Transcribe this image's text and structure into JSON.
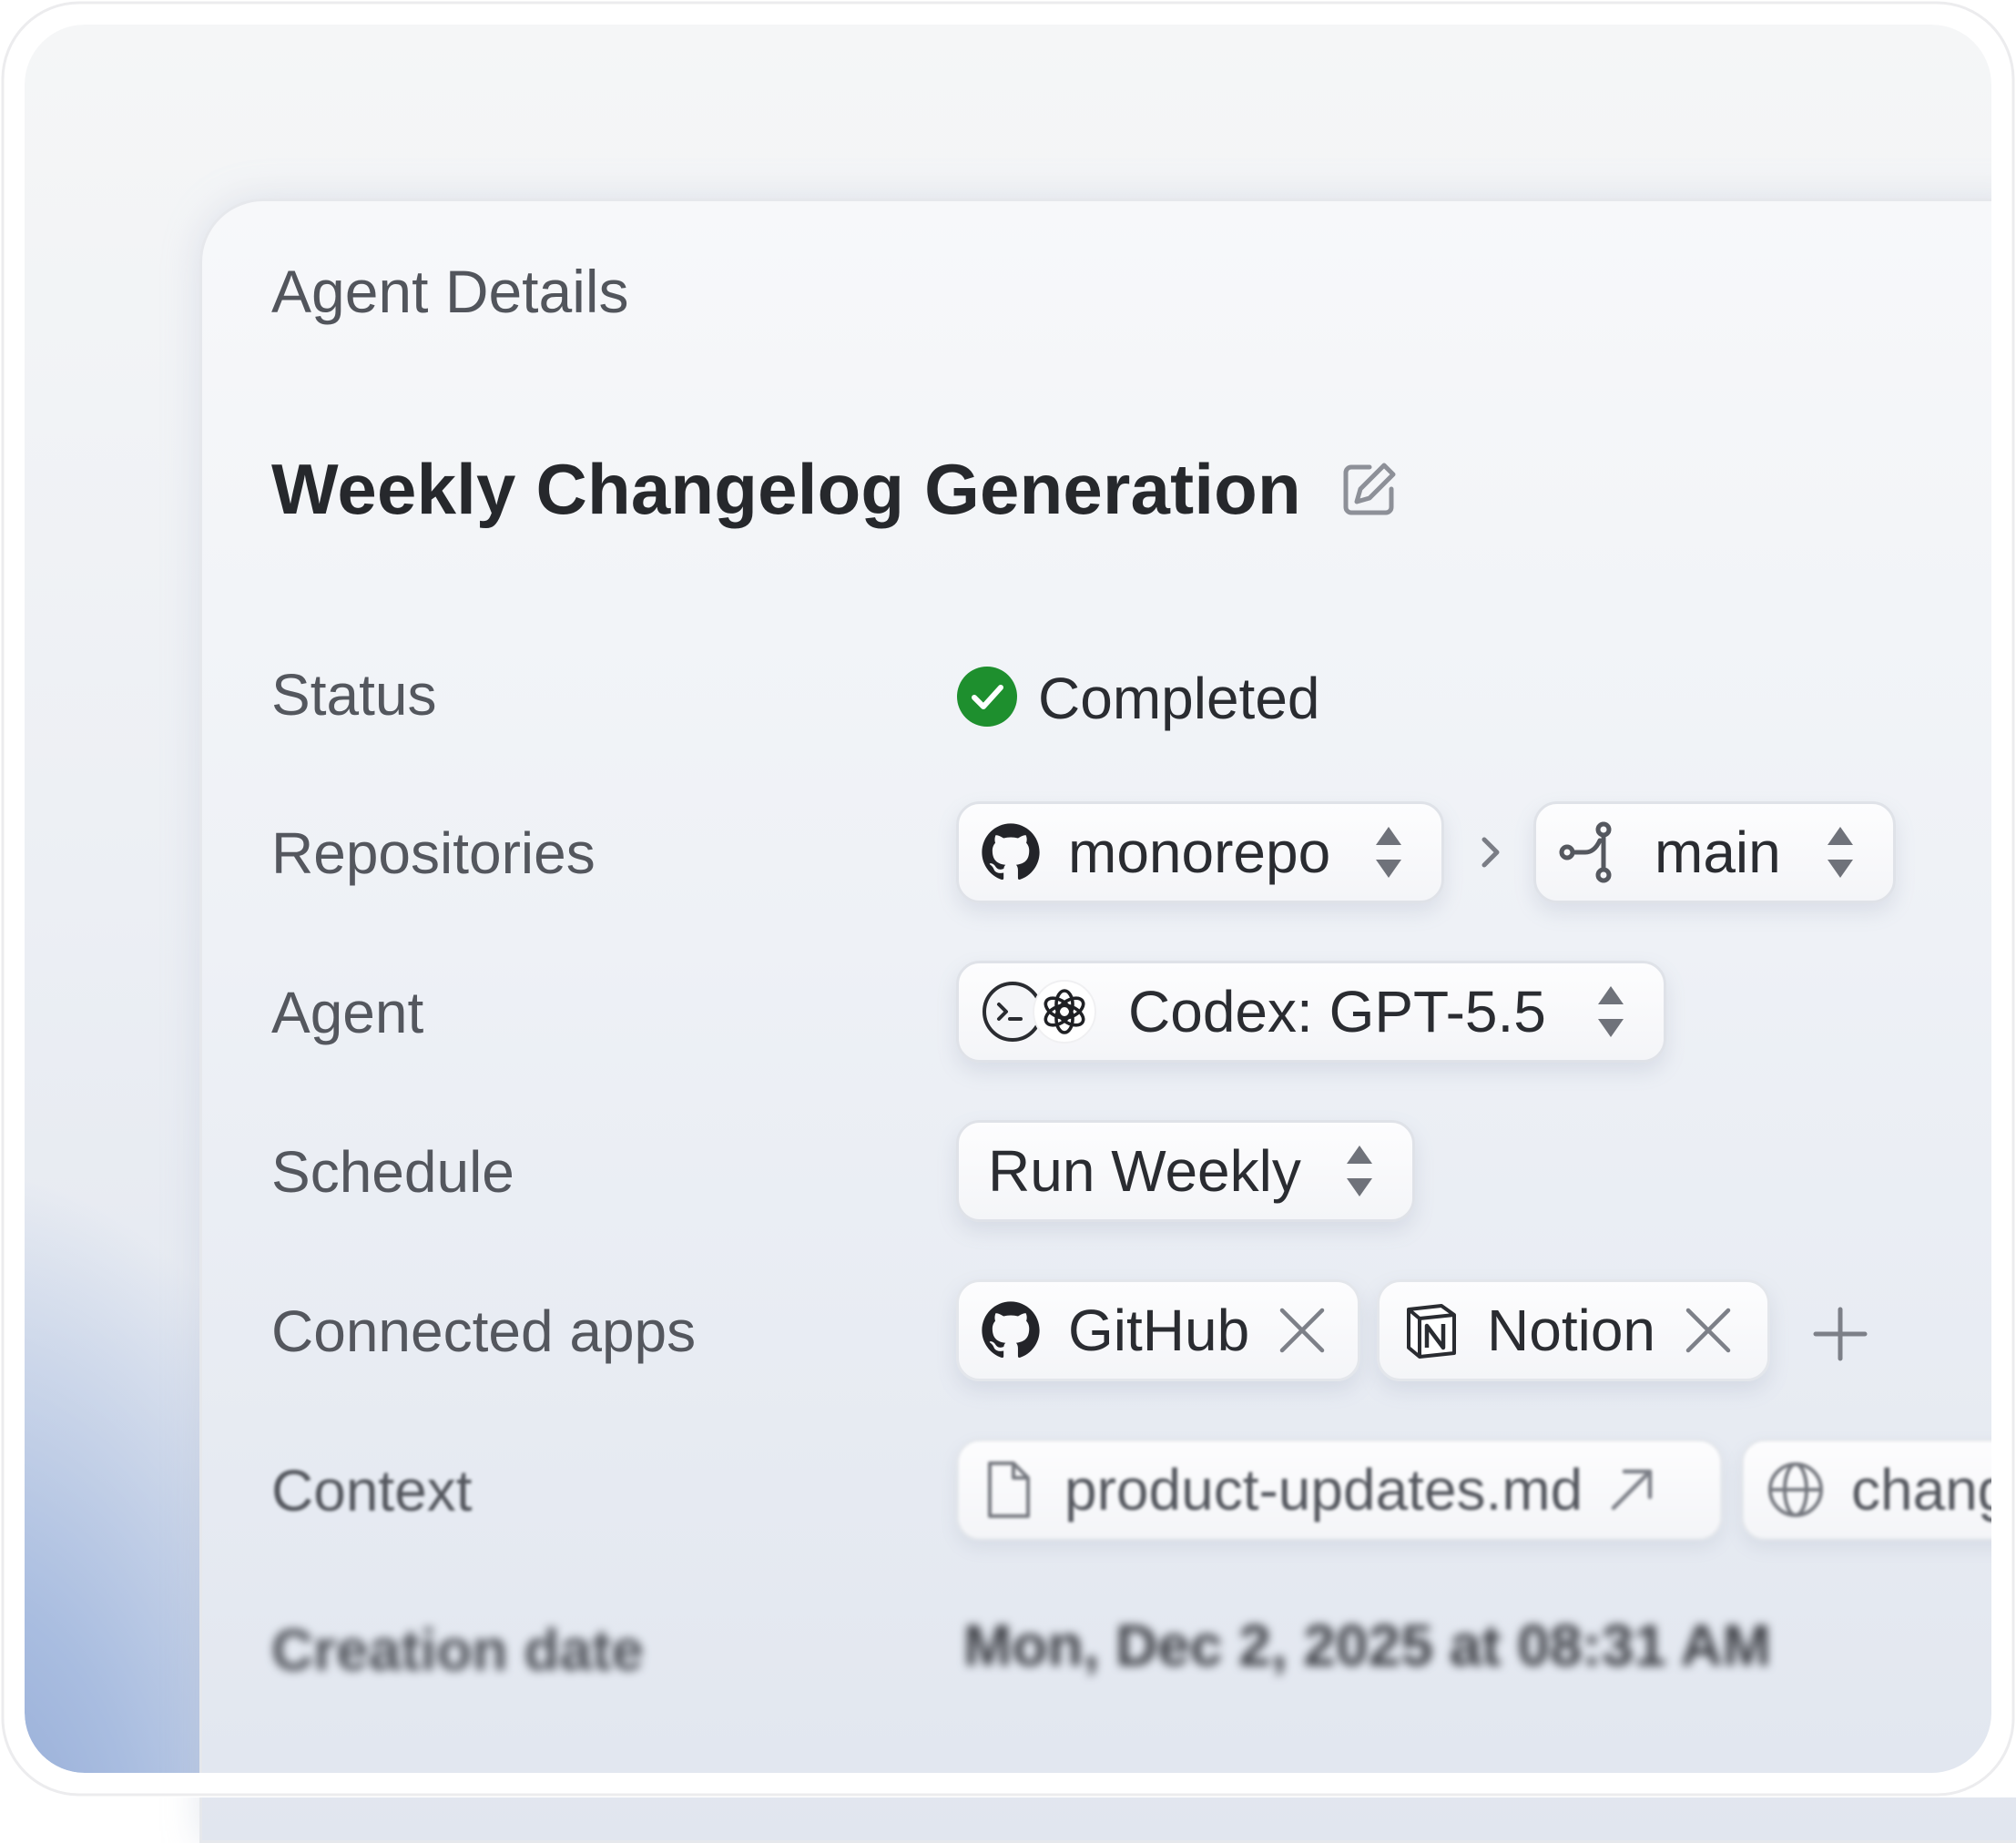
{
  "header": {
    "title": "Agent Details"
  },
  "agent": {
    "name": "Weekly Changelog Generation",
    "edit_icon": "edit-pencil-icon"
  },
  "labels": {
    "status": "Status",
    "repositories": "Repositories",
    "agent": "Agent",
    "schedule": "Schedule",
    "connected_apps": "Connected apps",
    "context": "Context",
    "creation_date": "Creation date"
  },
  "status": {
    "value": "Completed",
    "icon": "check-circle-icon",
    "color": "#1e8f2e"
  },
  "repositories": {
    "repo": "monorepo",
    "branch": "main",
    "separator_icon": "chevron-right-icon"
  },
  "agent_select": {
    "value": "Codex: GPT-5.5",
    "icons": [
      "terminal-icon",
      "openai-icon"
    ]
  },
  "schedule": {
    "value": "Run Weekly"
  },
  "connected_apps": [
    {
      "name": "GitHub",
      "icon": "github-icon"
    },
    {
      "name": "Notion",
      "icon": "notion-icon"
    }
  ],
  "context_items": [
    {
      "name": "product-updates.md",
      "icon": "file-icon"
    },
    {
      "name": "chang",
      "icon": "globe-icon"
    }
  ],
  "creation_date": {
    "value": "Mon, Dec 2, 2025 at 08:31 AM"
  }
}
